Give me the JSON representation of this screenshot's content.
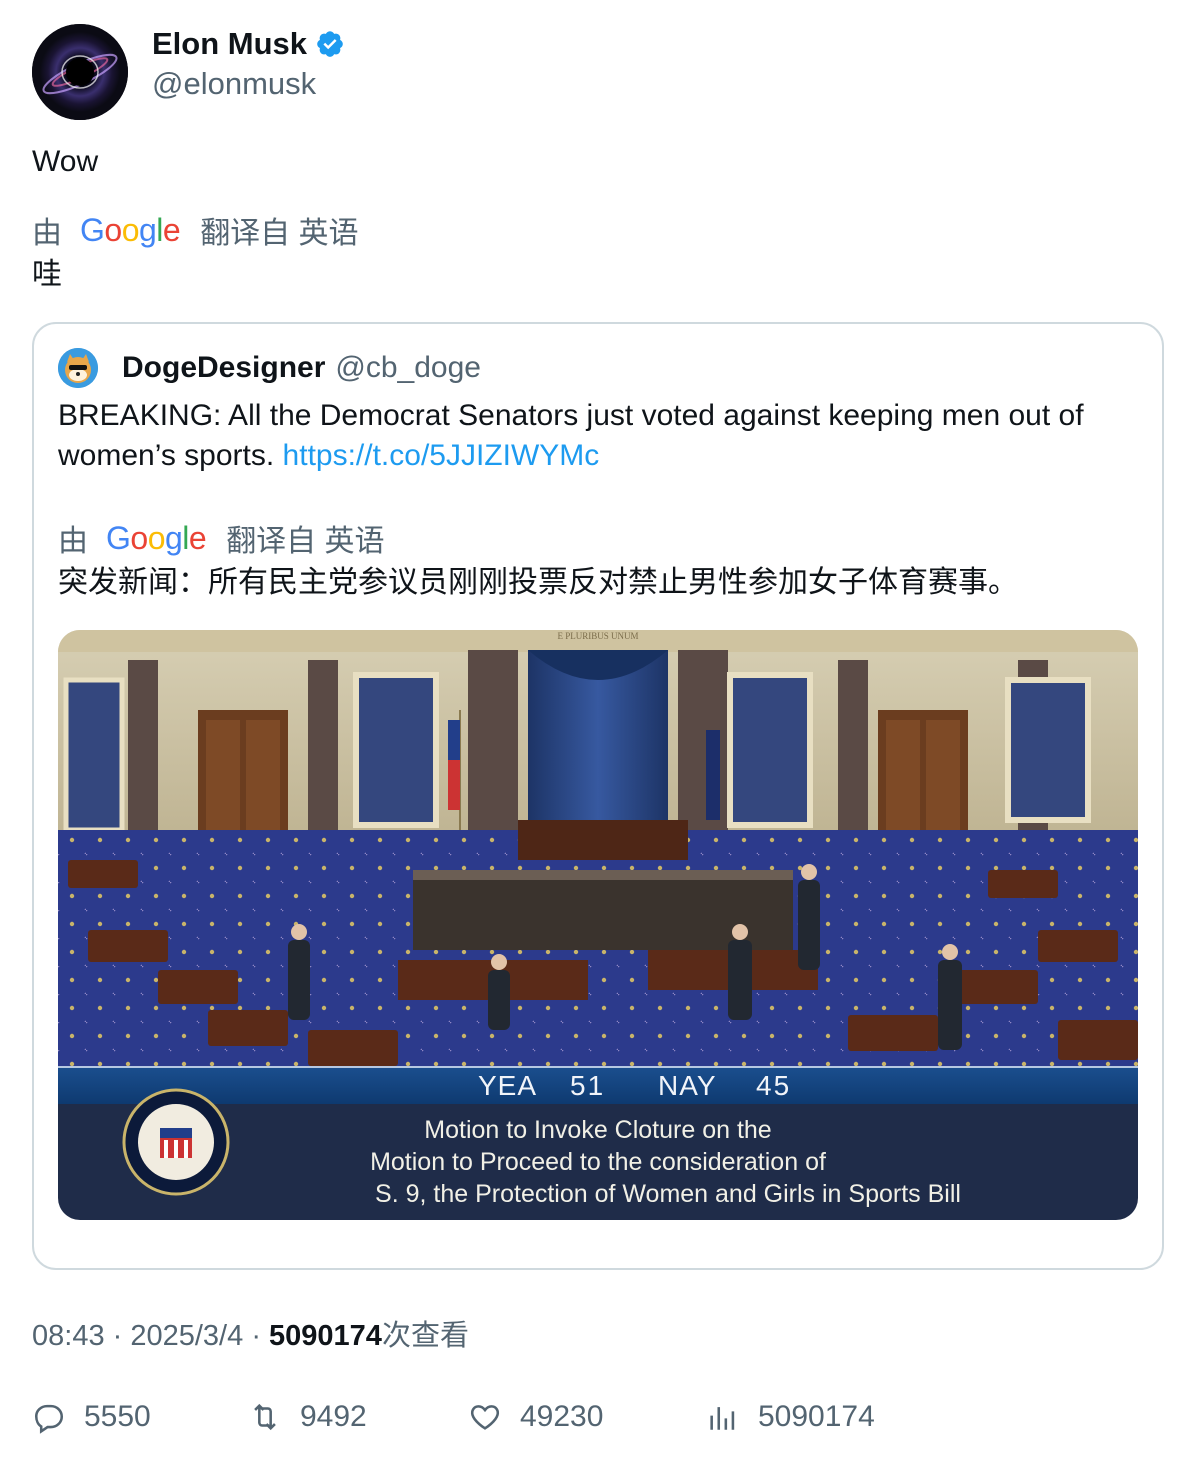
{
  "author": {
    "display_name": "Elon Musk",
    "handle": "@elonmusk",
    "verified": true
  },
  "tweet": {
    "text": "Wow",
    "translation_prefix": "由",
    "translation_suffix": "翻译自 英语",
    "translated_text": "哇"
  },
  "quoted_tweet": {
    "display_name": "DogeDesigner",
    "handle": "@cb_doge",
    "text": "BREAKING: All the Democrat Senators just voted against keeping men out of women’s sports.",
    "link": "https://t.co/5JJIZIWYMc",
    "translation_prefix": "由",
    "translation_suffix": "翻译自 英语",
    "translated_text": "突发新闻：所有民主党参议员刚刚投票反对禁止男性参加女子体育赛事。",
    "media": {
      "vote_line": "YEA 51 NAY 45",
      "yea_label": "YEA",
      "yea_count": "51",
      "nay_label": "NAY",
      "nay_count": "45",
      "caption_line1": "Motion to Invoke Cloture on the",
      "caption_line2": "Motion to Proceed to the consideration of",
      "caption_line3": "S. 9, the Protection of Women and Girls in Sports Bill",
      "seal_text": "UNITED STATES SENATE",
      "banner_text": "E PLURIBUS UNUM"
    }
  },
  "meta": {
    "time": "08:43",
    "date": "2025/3/4",
    "views_count": "5090174",
    "views_suffix": "次查看"
  },
  "actions": {
    "replies": "5550",
    "retweets": "9492",
    "likes": "49230",
    "views": "5090174"
  },
  "colors": {
    "accent": "#1d9bf0",
    "secondary_text": "#536471",
    "border": "#cfd9de"
  }
}
